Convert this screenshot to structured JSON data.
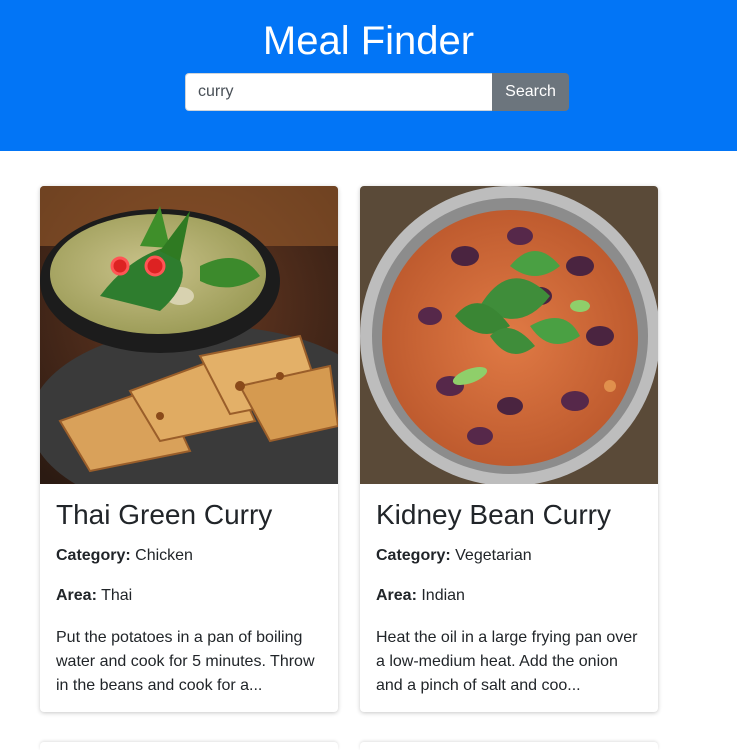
{
  "header": {
    "title": "Meal Finder",
    "background_color": "#0275f6"
  },
  "search": {
    "value": "curry",
    "button_label": "Search"
  },
  "meals": [
    {
      "title": "Thai Green Curry",
      "category_label": "Category:",
      "category": "Chicken",
      "area_label": "Area:",
      "area": "Thai",
      "description": "Put the potatoes in a pan of boiling water and cook for 5 minutes. Throw in the beans and cook for a...",
      "image": "thai-green-curry-photo"
    },
    {
      "title": "Kidney Bean Curry",
      "category_label": "Category:",
      "category": "Vegetarian",
      "area_label": "Area:",
      "area": "Indian",
      "description": "Heat the oil in a large frying pan over a low-medium heat. Add the onion and a pinch of salt and coo...",
      "image": "kidney-bean-curry-photo"
    }
  ]
}
